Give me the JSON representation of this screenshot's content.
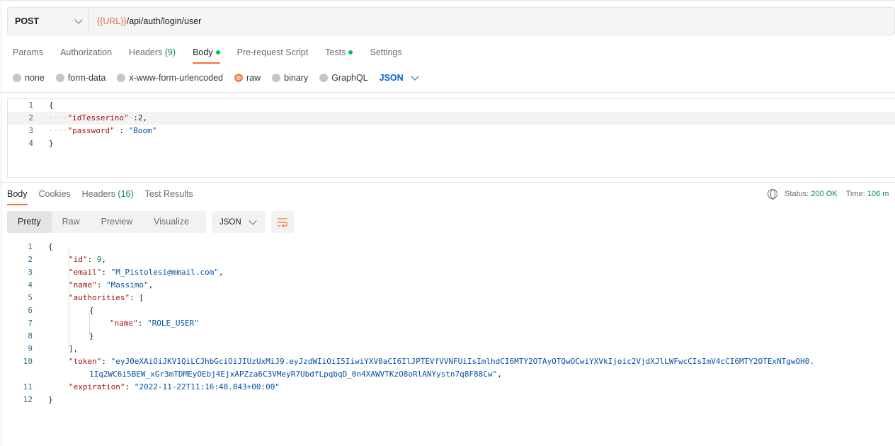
{
  "request": {
    "method": "POST",
    "url_var": "{{URL}}",
    "url_path": "/api/auth/login/user"
  },
  "request_tabs": [
    {
      "label": "Params"
    },
    {
      "label": "Authorization"
    },
    {
      "label": "Headers",
      "count": "(9)"
    },
    {
      "label": "Body",
      "dot": true
    },
    {
      "label": "Pre-request Script"
    },
    {
      "label": "Tests",
      "dot": true
    },
    {
      "label": "Settings"
    }
  ],
  "body_types": [
    "none",
    "form-data",
    "x-www-form-urlencoded",
    "raw",
    "binary",
    "GraphQL"
  ],
  "selected_body_type": "raw",
  "body_format": "JSON",
  "request_body_lines": [
    {
      "n": "1",
      "parts": [
        [
          "p",
          "{"
        ]
      ]
    },
    {
      "n": "2",
      "parts": [
        [
          "ws",
          "····"
        ],
        [
          "k",
          "\"idTesserino\""
        ],
        [
          "ws",
          "·"
        ],
        [
          "p",
          ":2,"
        ]
      ]
    },
    {
      "n": "3",
      "parts": [
        [
          "ws",
          "····"
        ],
        [
          "k",
          "\"password\""
        ],
        [
          "ws",
          "·"
        ],
        [
          "p",
          ":"
        ],
        [
          "ws",
          "·"
        ],
        [
          "s",
          "\"Boom\""
        ]
      ]
    },
    {
      "n": "4",
      "parts": [
        [
          "p",
          "}"
        ]
      ]
    }
  ],
  "response_tabs": [
    {
      "label": "Body"
    },
    {
      "label": "Cookies"
    },
    {
      "label": "Headers",
      "count": "(16)"
    },
    {
      "label": "Test Results"
    }
  ],
  "status": {
    "label": "Status:",
    "value": "200 OK",
    "time_label": "Time:",
    "time_value": "106 m"
  },
  "view_modes": [
    "Pretty",
    "Raw",
    "Preview",
    "Visualize"
  ],
  "response_format": "JSON",
  "response_lines": [
    {
      "n": "1",
      "indent": 0,
      "parts": [
        [
          "p",
          "{"
        ]
      ]
    },
    {
      "n": "2",
      "indent": 1,
      "parts": [
        [
          "k",
          "\"id\""
        ],
        [
          "p",
          ": "
        ],
        [
          "n",
          "9"
        ],
        [
          "p",
          ","
        ]
      ]
    },
    {
      "n": "3",
      "indent": 1,
      "parts": [
        [
          "k",
          "\"email\""
        ],
        [
          "p",
          ": "
        ],
        [
          "s",
          "\"M_Pistolesi@mmail.com\""
        ],
        [
          "p",
          ","
        ]
      ]
    },
    {
      "n": "4",
      "indent": 1,
      "parts": [
        [
          "k",
          "\"name\""
        ],
        [
          "p",
          ": "
        ],
        [
          "s",
          "\"Massimo\""
        ],
        [
          "p",
          ","
        ]
      ]
    },
    {
      "n": "5",
      "indent": 1,
      "parts": [
        [
          "k",
          "\"authorities\""
        ],
        [
          "p",
          ": ["
        ]
      ]
    },
    {
      "n": "6",
      "indent": 2,
      "parts": [
        [
          "p",
          "{"
        ]
      ]
    },
    {
      "n": "7",
      "indent": 3,
      "parts": [
        [
          "k",
          "\"name\""
        ],
        [
          "p",
          ": "
        ],
        [
          "s",
          "\"ROLE_USER\""
        ]
      ]
    },
    {
      "n": "8",
      "indent": 2,
      "parts": [
        [
          "p",
          "}"
        ]
      ]
    },
    {
      "n": "9",
      "indent": 1,
      "parts": [
        [
          "p",
          "],"
        ]
      ]
    },
    {
      "n": "10",
      "indent": 1,
      "parts": [
        [
          "k",
          "\"token\""
        ],
        [
          "p",
          ": "
        ],
        [
          "s",
          "\"eyJ0eXAiOiJKV1QiLCJhbGciOiJIUzUxMiJ9.eyJzdWIiOiI5IiwiYXV0aCI6IlJPTEVfVVNFUiIsImlhdCI6MTY2OTAyOTQwOCwiYXVkIjoic2VjdXJlLWFwcCIsImV4cCI6MTY2OTExNTgwOH0."
        ]
      ]
    },
    {
      "n": "",
      "indent": 2,
      "parts": [
        [
          "s",
          "1Iq2WC6i5BEW_xGr3mTDMEyOEbj4EjxAPZza6C3VMeyR7UbdfLpqbqD_0n4XAWVTKzO8oRlANYystn7q8F88Cw\""
        ],
        [
          "p",
          ","
        ]
      ]
    },
    {
      "n": "11",
      "indent": 1,
      "parts": [
        [
          "k",
          "\"expiration\""
        ],
        [
          "p",
          ": "
        ],
        [
          "s",
          "\"2022-11-22T11:16:48.843+00:00\""
        ]
      ]
    },
    {
      "n": "12",
      "indent": 0,
      "parts": [
        [
          "p",
          "}"
        ]
      ]
    }
  ]
}
